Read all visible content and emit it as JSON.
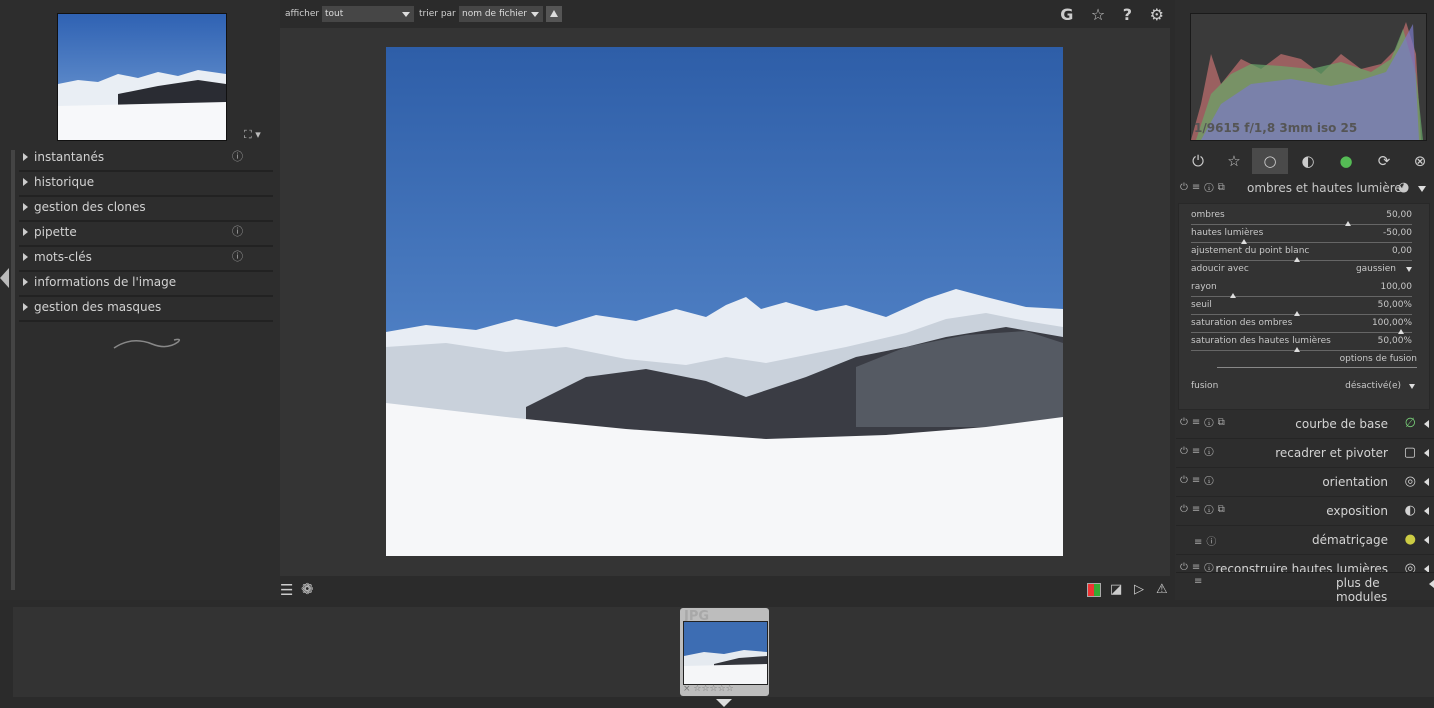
{
  "toolbar": {
    "show_label": "afficher",
    "show_value": "tout",
    "sort_label": "trier par",
    "sort_value": "nom de fichier",
    "icons": [
      "grouping-icon",
      "star-icon",
      "help-icon",
      "gear-icon"
    ],
    "icon_glyphs": "G ☆ ? ⚙"
  },
  "left_modules": [
    {
      "label": "instantanés",
      "info": true
    },
    {
      "label": "historique",
      "info": false
    },
    {
      "label": "gestion des clones",
      "info": false
    },
    {
      "label": "pipette",
      "info": true
    },
    {
      "label": "mots-clés",
      "info": true
    },
    {
      "label": "informations de l'image",
      "info": false
    },
    {
      "label": "gestion des masques",
      "info": false
    }
  ],
  "histogram": {
    "info": "1/9615 f/1,8 3mm iso 25"
  },
  "shadows_highlights": {
    "title": "ombres et hautes lumières",
    "sliders": [
      {
        "label": "ombres",
        "value": "50,00",
        "pos": 0.71
      },
      {
        "label": "hautes lumières",
        "value": "-50,00",
        "pos": 0.24
      },
      {
        "label": "ajustement du point blanc",
        "value": "0,00",
        "pos": 0.48
      },
      {
        "label": "adoucir avec",
        "value": "gaussien",
        "dropdown": true
      },
      {
        "label": "rayon",
        "value": "100,00",
        "pos": 0.19
      },
      {
        "label": "seuil",
        "value": "50,00%",
        "pos": 0.48
      },
      {
        "label": "saturation des ombres",
        "value": "100,00%",
        "pos": 0.95
      },
      {
        "label": "saturation des hautes lumières",
        "value": "50,00%",
        "pos": 0.48
      }
    ],
    "blend_options": "options de fusion",
    "blend_label": "fusion",
    "blend_value": "désactivé(e)"
  },
  "right_modules": [
    {
      "name": "courbe de base",
      "icon": "∅"
    },
    {
      "name": "recadrer et pivoter",
      "icon": "▢"
    },
    {
      "name": "orientation",
      "icon": "◎"
    },
    {
      "name": "exposition",
      "icon": "◐"
    },
    {
      "name": "dématriçage",
      "icon": "●"
    },
    {
      "name": "reconstruire hautes lumières",
      "icon": "◎"
    }
  ],
  "more_modules": "plus de modules",
  "filmstrip": {
    "ext": "JPG",
    "stars": "× ☆☆☆☆☆"
  }
}
